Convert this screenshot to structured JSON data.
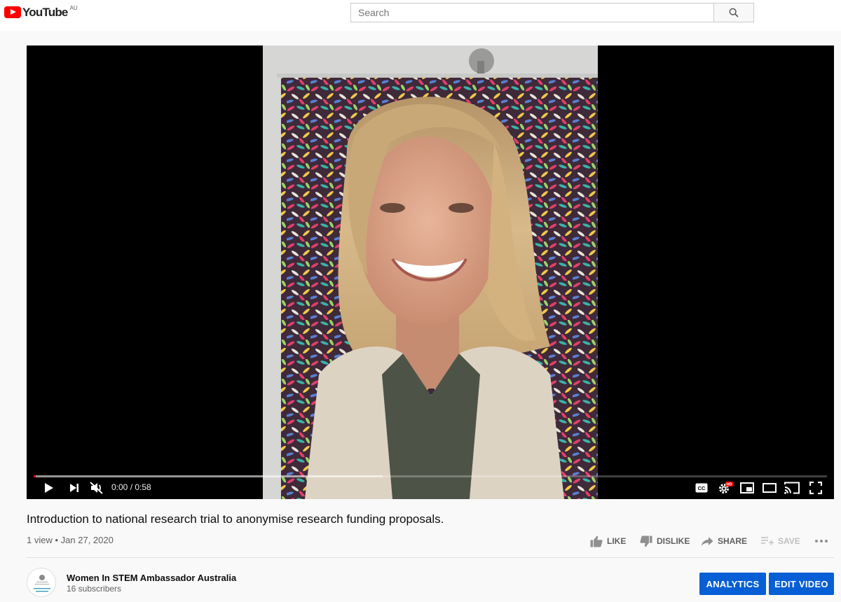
{
  "header": {
    "logo_text": "YouTube",
    "country_code": "AU",
    "search_placeholder": "Search"
  },
  "player": {
    "time_display": "0:00 / 0:58",
    "progress_played": 0.0,
    "progress_buffered": 0.44,
    "muted": true,
    "quality_badge": "HD"
  },
  "video": {
    "title": "Introduction to national research trial to anonymise research funding proposals.",
    "views": "1 view",
    "separator": "•",
    "date": "Jan 27, 2020"
  },
  "actions": {
    "like": "LIKE",
    "dislike": "DISLIKE",
    "share": "SHARE",
    "save": "SAVE"
  },
  "channel": {
    "name": "Women In STEM Ambassador Australia",
    "subscribers": "16 subscribers",
    "avatar_text": "Women in STEM Ambassador"
  },
  "buttons": {
    "analytics": "ANALYTICS",
    "edit_video": "EDIT VIDEO"
  },
  "colors": {
    "brand_red": "#ff0000",
    "accent_blue": "#065fd4",
    "text_secondary": "#606060"
  }
}
